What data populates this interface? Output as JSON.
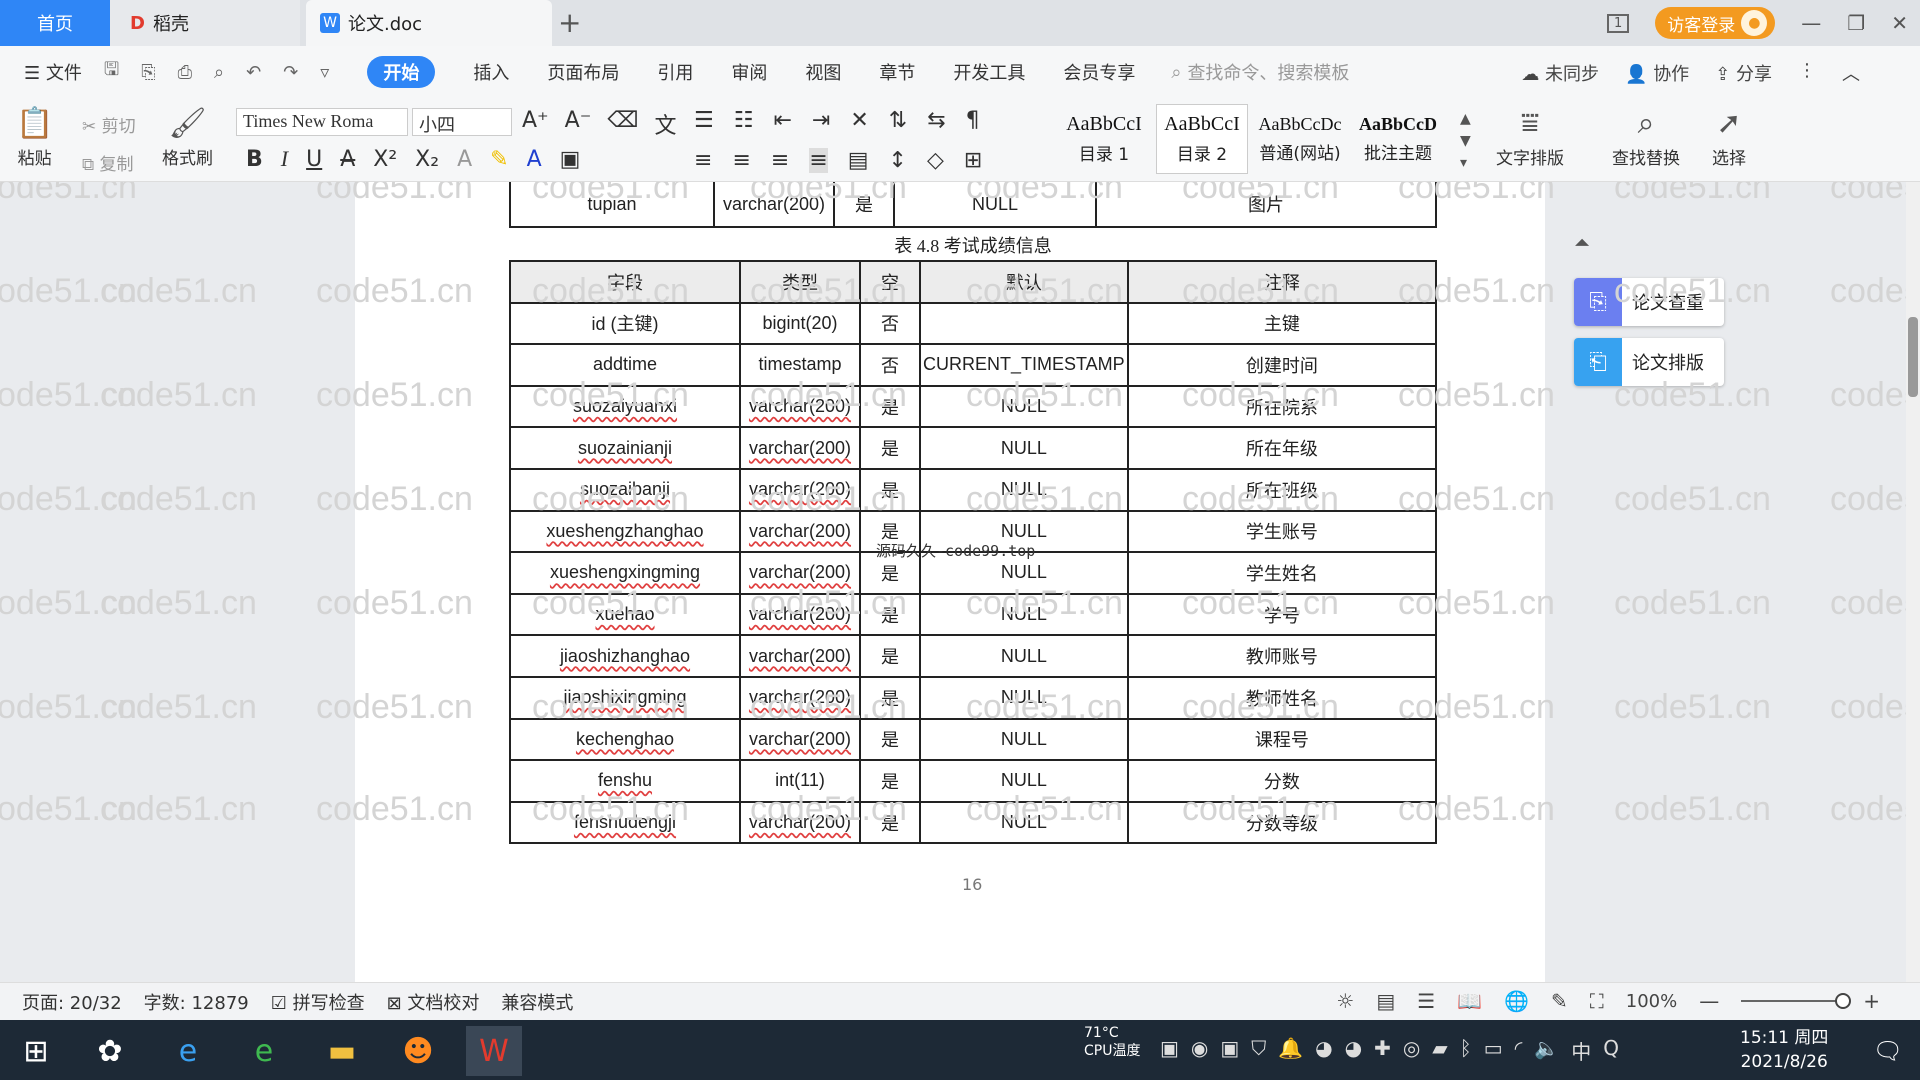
{
  "tabs": {
    "home": "首页",
    "daoke": "稻壳",
    "doc": "论文.doc",
    "new_tab": "+"
  },
  "titlebar": {
    "visitor_login": "访客登录",
    "page_indicator": "1"
  },
  "menu": {
    "file": "文件",
    "items": [
      "开始",
      "插入",
      "页面布局",
      "引用",
      "审阅",
      "视图",
      "章节",
      "开发工具",
      "会员专享"
    ],
    "active_index": 0,
    "search_placeholder": "查找命令、搜索模板",
    "right": {
      "sync": "未同步",
      "collab": "协作",
      "share": "分享"
    }
  },
  "ribbon": {
    "paste": "粘贴",
    "cut": "剪切",
    "copy": "复制",
    "format_painter": "格式刷",
    "font_name": "Times New Roma",
    "font_size": "小四",
    "styles": [
      {
        "preview": "AaBbCcI",
        "name": "目录 1"
      },
      {
        "preview": "AaBbCcI",
        "name": "目录 2"
      },
      {
        "preview": "AaBbCcDc",
        "name": "普通(网站)"
      },
      {
        "preview": "AaBbCcD",
        "name": "批注主题"
      }
    ],
    "text_layout": "文字排版",
    "find_replace": "查找替换",
    "select": "选择"
  },
  "document": {
    "prev_row": [
      "tupian",
      "varchar(200)",
      "是",
      "NULL",
      "图片"
    ],
    "caption": "表 4.8  考试成绩信息",
    "headers": [
      "字段",
      "类型",
      "空",
      "默认",
      "注释"
    ],
    "rows": [
      [
        "id (主键)",
        "bigint(20)",
        "否",
        "",
        "主键"
      ],
      [
        "addtime",
        "timestamp",
        "否",
        "CURRENT_TIMESTAMP",
        "创建时间"
      ],
      [
        "suozaiyuanxi",
        "varchar(200)",
        "是",
        "NULL",
        "所在院系"
      ],
      [
        "suozainianji",
        "varchar(200)",
        "是",
        "NULL",
        "所在年级"
      ],
      [
        "suozaibanji",
        "varchar(200)",
        "是",
        "NULL",
        "所在班级"
      ],
      [
        "xueshengzhanghao",
        "varchar(200)",
        "是",
        "NULL",
        "学生账号"
      ],
      [
        "xueshengxingming",
        "varchar(200)",
        "是",
        "NULL",
        "学生姓名"
      ],
      [
        "xuehao",
        "varchar(200)",
        "是",
        "NULL",
        "学号"
      ],
      [
        "jiaoshizhanghao",
        "varchar(200)",
        "是",
        "NULL",
        "教师账号"
      ],
      [
        "jiaoshixingming",
        "varchar(200)",
        "是",
        "NULL",
        "教师姓名"
      ],
      [
        "kechenghao",
        "varchar(200)",
        "是",
        "NULL",
        "课程号"
      ],
      [
        "fenshu",
        "int(11)",
        "是",
        "NULL",
        "分数"
      ],
      [
        "fenshudengji",
        "varchar(200)",
        "是",
        "NULL",
        "分数等级"
      ]
    ],
    "page_number": "16",
    "overlay": "源码久久-code99.top",
    "watermark": "code51.cn"
  },
  "side_panel": {
    "check": "论文查重",
    "layout": "论文排版"
  },
  "status": {
    "page": "页面: 20/32",
    "words": "字数: 12879",
    "spell": "拼写检查",
    "proof": "文档校对",
    "compat": "兼容模式",
    "zoom": "100%"
  },
  "taskbar": {
    "temp": "71°C",
    "cpu": "CPU温度",
    "time": "15:11 周四",
    "date": "2021/8/26",
    "ime": "中"
  },
  "colors": {
    "accent": "#2f86f6",
    "visitor": "#f39a20",
    "taskbar": "#1d2936"
  }
}
